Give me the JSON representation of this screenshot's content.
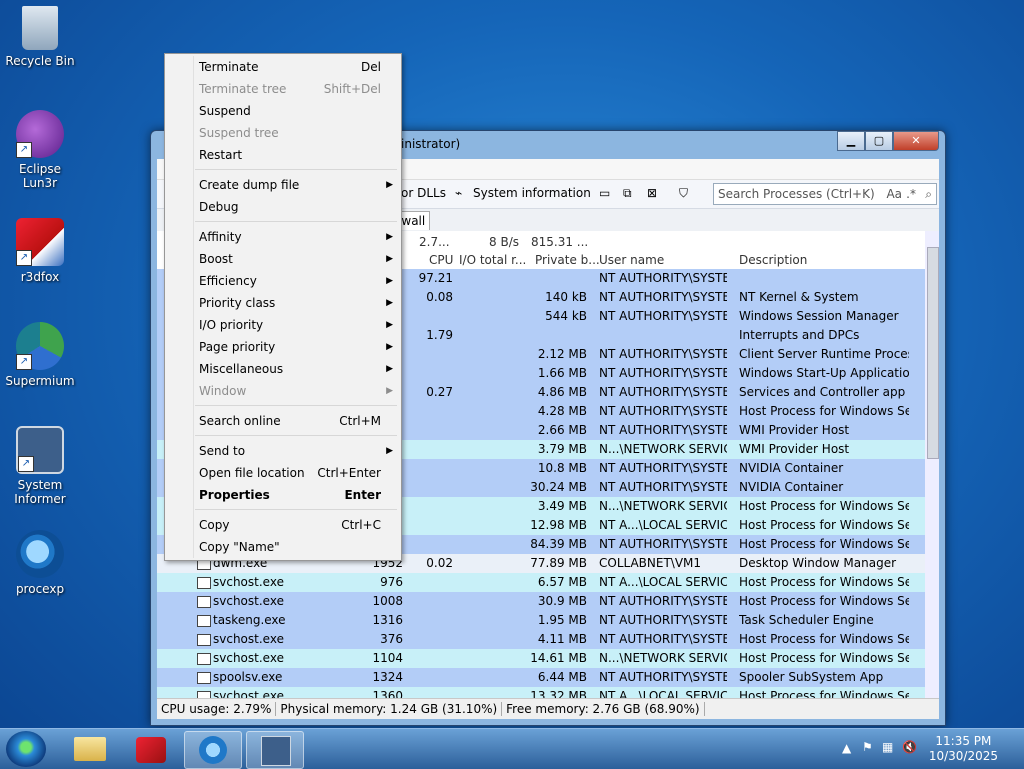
{
  "desktop": {
    "icons": [
      {
        "label": "Recycle Bin"
      },
      {
        "label": "Eclipse Lun3r"
      },
      {
        "label": "r3dfox"
      },
      {
        "label": "Supermium"
      },
      {
        "label": "System Informer"
      },
      {
        "label": "procexp"
      }
    ]
  },
  "window": {
    "title_fragment": "inistrator)",
    "toolbar": {
      "dlls_label": "or DLLs",
      "sysinfo_label": "System information",
      "search_placeholder": "Search Processes (Ctrl+K)",
      "search_options": "Aa"
    },
    "tab_fragment": "ewall",
    "summary": {
      "cpu": "2.7...",
      "io": "8 B/s",
      "private": "815.31 ..."
    },
    "columns": {
      "cpu": "CPU",
      "io": "I/O total r...",
      "private": "Private b...",
      "user": "User name",
      "desc": "Description"
    },
    "rows": [
      {
        "name": "",
        "pid": "",
        "cpu": "97.21",
        "priv": "",
        "user": "NT AUTHORITY\\SYSTEM",
        "desc": ""
      },
      {
        "name": "",
        "pid": "",
        "cpu": "0.08",
        "priv": "140 kB",
        "user": "NT AUTHORITY\\SYSTEM",
        "desc": "NT Kernel & System"
      },
      {
        "name": "",
        "pid": "",
        "cpu": "",
        "priv": "544 kB",
        "user": "NT AUTHORITY\\SYSTEM",
        "desc": "Windows Session Manager"
      },
      {
        "name": "",
        "pid": "",
        "cpu": "1.79",
        "priv": "",
        "user": "",
        "desc": "Interrupts and DPCs"
      },
      {
        "name": "",
        "pid": "",
        "cpu": "",
        "priv": "2.12 MB",
        "user": "NT AUTHORITY\\SYSTEM",
        "desc": "Client Server Runtime Process"
      },
      {
        "name": "",
        "pid": "",
        "cpu": "",
        "priv": "1.66 MB",
        "user": "NT AUTHORITY\\SYSTEM",
        "desc": "Windows Start-Up Application"
      },
      {
        "name": "",
        "pid": "",
        "cpu": "0.27",
        "priv": "4.86 MB",
        "user": "NT AUTHORITY\\SYSTEM",
        "desc": "Services and Controller app"
      },
      {
        "name": "",
        "pid": "",
        "cpu": "",
        "priv": "4.28 MB",
        "user": "NT AUTHORITY\\SYSTEM",
        "desc": "Host Process for Windows Ser..."
      },
      {
        "name": "",
        "pid": "",
        "cpu": "",
        "priv": "2.66 MB",
        "user": "NT AUTHORITY\\SYSTEM",
        "desc": "WMI Provider Host"
      },
      {
        "name": "",
        "pid": "",
        "cpu": "",
        "priv": "3.79 MB",
        "user": "N...\\NETWORK SERVICE",
        "desc": "WMI Provider Host"
      },
      {
        "name": "",
        "pid": "",
        "cpu": "",
        "priv": "10.8 MB",
        "user": "NT AUTHORITY\\SYSTEM",
        "desc": "NVIDIA Container"
      },
      {
        "name": "",
        "pid": "",
        "cpu": "",
        "priv": "30.24 MB",
        "user": "NT AUTHORITY\\SYSTEM",
        "desc": "NVIDIA Container"
      },
      {
        "name": "",
        "pid": "",
        "cpu": "",
        "priv": "3.49 MB",
        "user": "N...\\NETWORK SERVICE",
        "desc": "Host Process for Windows Ser..."
      },
      {
        "name": "",
        "pid": "",
        "cpu": "",
        "priv": "12.98 MB",
        "user": "NT A...\\LOCAL SERVICE",
        "desc": "Host Process for Windows Ser..."
      },
      {
        "name": "",
        "pid": "",
        "cpu": "",
        "priv": "84.39 MB",
        "user": "NT AUTHORITY\\SYSTEM",
        "desc": "Host Process for Windows Ser..."
      },
      {
        "name": "dwm.exe",
        "pid": "1952",
        "cpu": "0.02",
        "priv": "77.89 MB",
        "user": "COLLABNET\\VM1",
        "desc": "Desktop Window Manager"
      },
      {
        "name": "svchost.exe",
        "pid": "976",
        "cpu": "",
        "priv": "6.57 MB",
        "user": "NT A...\\LOCAL SERVICE",
        "desc": "Host Process for Windows Ser..."
      },
      {
        "name": "svchost.exe",
        "pid": "1008",
        "cpu": "",
        "priv": "30.9 MB",
        "user": "NT AUTHORITY\\SYSTEM",
        "desc": "Host Process for Windows Ser..."
      },
      {
        "name": "taskeng.exe",
        "pid": "1316",
        "cpu": "",
        "priv": "1.95 MB",
        "user": "NT AUTHORITY\\SYSTEM",
        "desc": "Task Scheduler Engine"
      },
      {
        "name": "svchost.exe",
        "pid": "376",
        "cpu": "",
        "priv": "4.11 MB",
        "user": "NT AUTHORITY\\SYSTEM",
        "desc": "Host Process for Windows Ser..."
      },
      {
        "name": "svchost.exe",
        "pid": "1104",
        "cpu": "",
        "priv": "14.61 MB",
        "user": "N...\\NETWORK SERVICE",
        "desc": "Host Process for Windows Ser..."
      },
      {
        "name": "spoolsv.exe",
        "pid": "1324",
        "cpu": "",
        "priv": "6.44 MB",
        "user": "NT AUTHORITY\\SYSTEM",
        "desc": "Spooler SubSystem App"
      },
      {
        "name": "svchost.exe",
        "pid": "1360",
        "cpu": "",
        "priv": "13.32 MB",
        "user": "NT A...\\LOCAL SERVICE",
        "desc": "Host Process for Windows Ser..."
      }
    ],
    "row_colors": [
      "#b3cdf7",
      "#b3cdf7",
      "#b3cdf7",
      "#b3cdf7",
      "#b3cdf7",
      "#b3cdf7",
      "#b3cdf7",
      "#b3cdf7",
      "#b3cdf7",
      "#c8f0f8",
      "#b3cdf7",
      "#b3cdf7",
      "#c8f0f8",
      "#c8f0f8",
      "#b3cdf7",
      "#eaf0f8",
      "#c8f0f8",
      "#b3cdf7",
      "#b3cdf7",
      "#b3cdf7",
      "#c8f0f8",
      "#b3cdf7",
      "#c8f0f8"
    ],
    "status": {
      "cpu": "CPU usage: 2.79%",
      "phys": "Physical memory: 1.24 GB (31.10%)",
      "free": "Free memory: 2.76 GB (68.90%)"
    }
  },
  "context_menu": {
    "items": [
      {
        "label": "Terminate",
        "shortcut": "Del",
        "type": "item"
      },
      {
        "label": "Terminate tree",
        "shortcut": "Shift+Del",
        "type": "disabled"
      },
      {
        "label": "Suspend",
        "shortcut": "",
        "type": "item"
      },
      {
        "label": "Suspend tree",
        "shortcut": "",
        "type": "disabled"
      },
      {
        "label": "Restart",
        "shortcut": "",
        "type": "item"
      },
      {
        "type": "sep"
      },
      {
        "label": "Create dump file",
        "shortcut": "",
        "type": "submenu"
      },
      {
        "label": "Debug",
        "shortcut": "",
        "type": "item"
      },
      {
        "type": "sep"
      },
      {
        "label": "Affinity",
        "shortcut": "",
        "type": "submenu"
      },
      {
        "label": "Boost",
        "shortcut": "",
        "type": "submenu"
      },
      {
        "label": "Efficiency",
        "shortcut": "",
        "type": "submenu"
      },
      {
        "label": "Priority class",
        "shortcut": "",
        "type": "submenu"
      },
      {
        "label": "I/O priority",
        "shortcut": "",
        "type": "submenu"
      },
      {
        "label": "Page priority",
        "shortcut": "",
        "type": "submenu"
      },
      {
        "label": "Miscellaneous",
        "shortcut": "",
        "type": "submenu"
      },
      {
        "label": "Window",
        "shortcut": "",
        "type": "disabled-submenu"
      },
      {
        "type": "sep"
      },
      {
        "label": "Search online",
        "shortcut": "Ctrl+M",
        "type": "item"
      },
      {
        "type": "sep"
      },
      {
        "label": "Send to",
        "shortcut": "",
        "type": "submenu"
      },
      {
        "label": "Open file location",
        "shortcut": "Ctrl+Enter",
        "type": "item"
      },
      {
        "label": "Properties",
        "shortcut": "Enter",
        "type": "bold"
      },
      {
        "type": "sep"
      },
      {
        "label": "Copy",
        "shortcut": "Ctrl+C",
        "type": "item"
      },
      {
        "label": "Copy \"Name\"",
        "shortcut": "",
        "type": "item"
      }
    ]
  },
  "taskbar": {
    "time": "11:35 PM",
    "date": "10/30/2025"
  }
}
